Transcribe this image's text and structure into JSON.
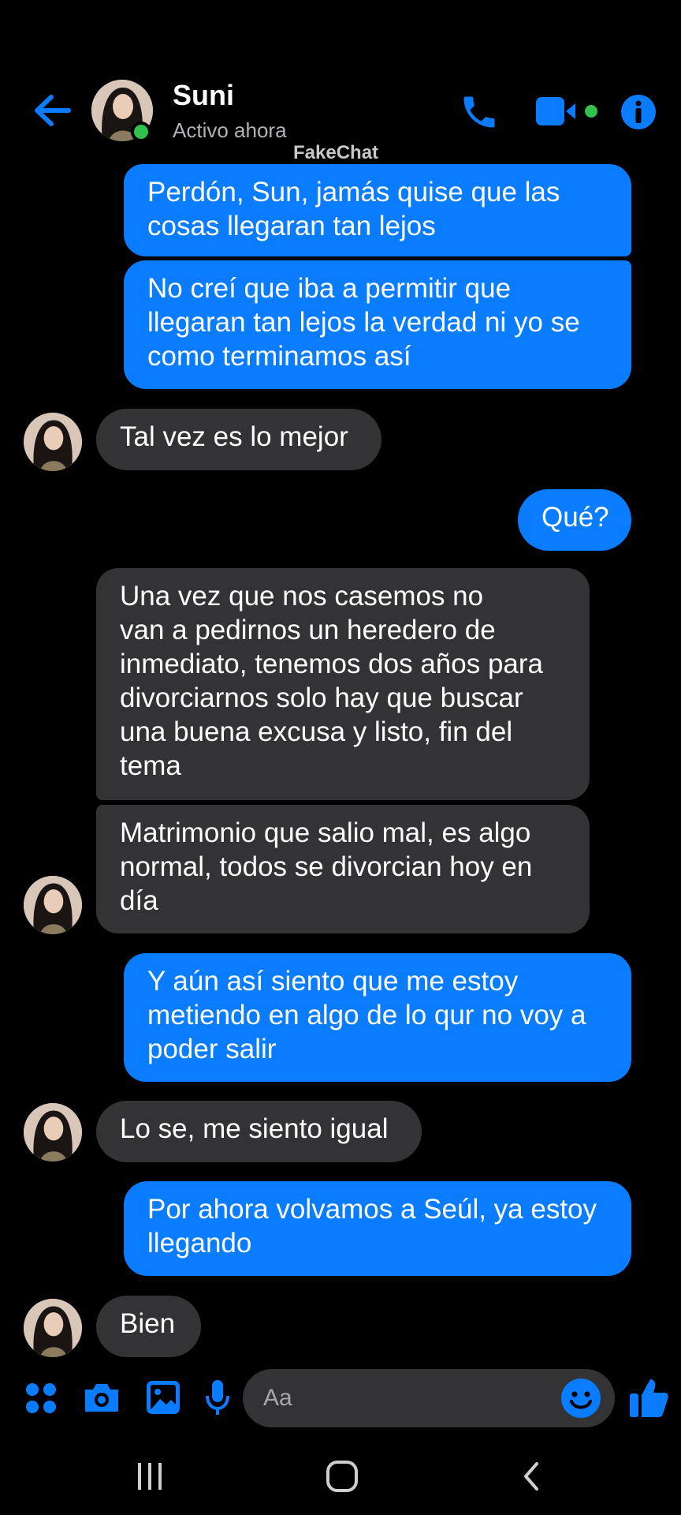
{
  "colors": {
    "accent": "#0a7cff",
    "incoming_bubble": "#333336",
    "online": "#31c24d",
    "background": "#000000"
  },
  "header": {
    "contact_name": "Suni",
    "status": "Activo ahora",
    "watermark": "FakeChat",
    "icons": [
      "back-arrow-icon",
      "phone-icon",
      "video-camera-icon",
      "info-icon"
    ]
  },
  "messages": [
    {
      "from": "me",
      "text": "Perdón, Sun, jamás quise que las\ncosas llegaran tan lejos"
    },
    {
      "from": "me",
      "text": "No creí que iba a permitir que\nllegaran tan lejos la verdad ni yo se\ncomo terminamos así"
    },
    {
      "from": "them",
      "text": "Tal vez es lo mejor"
    },
    {
      "from": "me",
      "text": "Qué?"
    },
    {
      "from": "them",
      "text": "Una vez que nos casemos no\nvan a pedirnos un heredero de\ninmediato, tenemos dos años para\ndivorciarnos solo hay que buscar\nuna buena excusa y listo, fin del\ntema"
    },
    {
      "from": "them",
      "text": "Matrimonio que salio mal, es algo\nnormal, todos se divorcian hoy en\ndía"
    },
    {
      "from": "me",
      "text": "Y aún así siento que me estoy\nmetiendo en algo de lo qur no voy a\npoder salir"
    },
    {
      "from": "them",
      "text": "Lo se, me siento igual"
    },
    {
      "from": "me",
      "text": "Por ahora volvamos a Seúl, ya estoy\nllegando"
    },
    {
      "from": "them",
      "text": "Bien"
    }
  ],
  "composer": {
    "placeholder": "Aa",
    "icons": [
      "apps-icon",
      "camera-icon",
      "gallery-icon",
      "microphone-icon",
      "emoji-icon",
      "thumbs-up-icon"
    ]
  },
  "navbar": {
    "icons": [
      "recents-icon",
      "home-icon",
      "back-icon"
    ]
  }
}
